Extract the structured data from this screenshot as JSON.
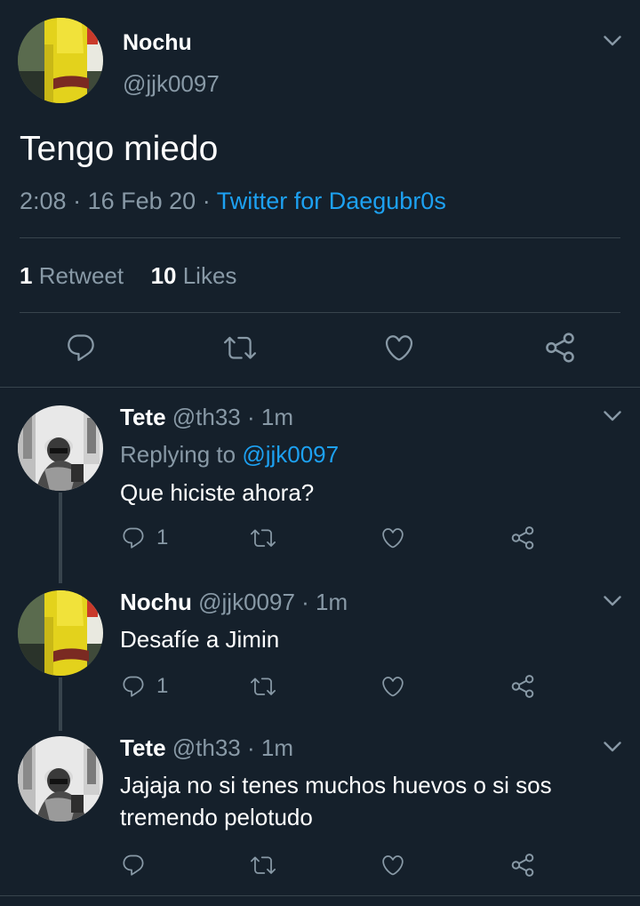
{
  "main_tweet": {
    "author_name": "Nochu",
    "author_handle": "@jjk0097",
    "text": "Tengo miedo",
    "time": "2:08",
    "sep1": "·",
    "date": "16 Feb 20",
    "sep2": "·",
    "source": "Twitter for Daegubr0s",
    "retweet_count": "1",
    "retweet_label": "Retweet",
    "likes_count": "10",
    "likes_label": "Likes"
  },
  "replies": [
    {
      "author_name": "Tete",
      "author_handle": "@th33",
      "time": "· 1m",
      "replying_prefix": "Replying to",
      "replying_handle": "@jjk0097",
      "text_line1": "Que hiciste ahora?",
      "reply_count": "1"
    },
    {
      "author_name": "Nochu",
      "author_handle": "@jjk0097",
      "time": "· 1m",
      "text_line1": "Desafíe a Jimin",
      "reply_count": "1"
    },
    {
      "author_name": "Tete",
      "author_handle": "@th33",
      "time": "· 1m",
      "text_line1": "Jajaja no si tenes muchos huevos o si sos",
      "text_line2": "tremendo pelotudo",
      "reply_count": ""
    }
  ],
  "icons": {
    "reply": "reply-icon",
    "retweet": "retweet-icon",
    "like": "heart-icon",
    "share": "share-icon",
    "menu": "chevron-down-icon"
  },
  "colors": {
    "background": "#15202b",
    "text": "#ffffff",
    "secondary": "#8899a6",
    "link": "#1da1f2",
    "divider": "#38444d"
  }
}
